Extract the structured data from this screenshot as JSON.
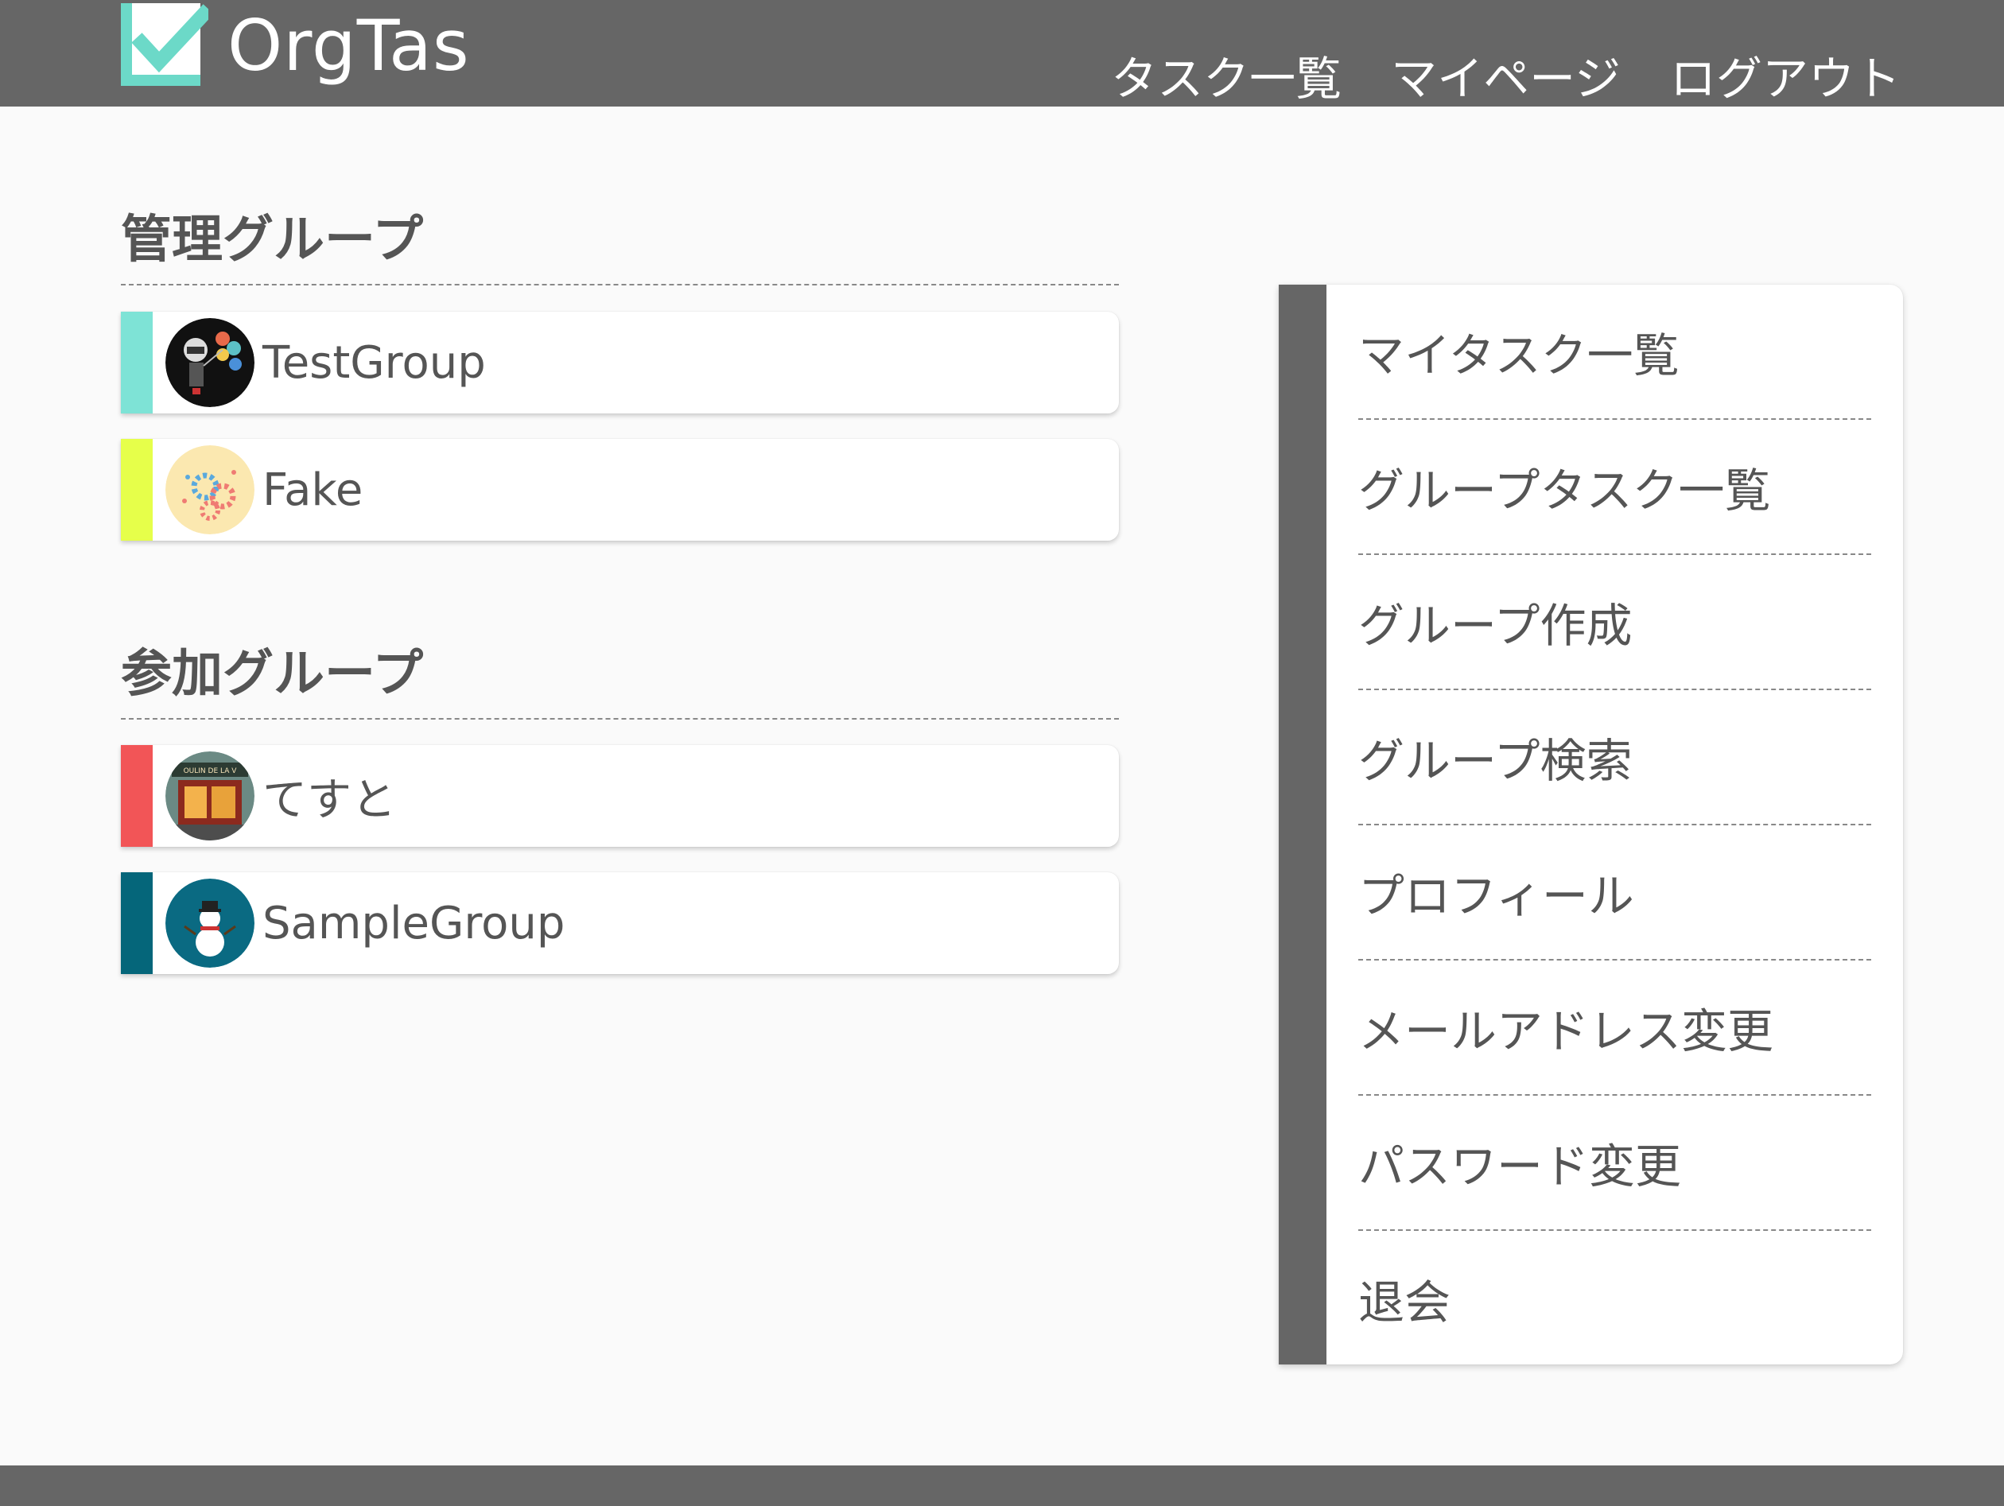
{
  "header": {
    "logo_text": "OrgTas",
    "nav": [
      "タスク一覧",
      "マイページ",
      "ログアウト"
    ]
  },
  "managed": {
    "title": "管理グループ",
    "groups": [
      {
        "name": "TestGroup",
        "color": "#7ee3d6",
        "avatar": "robot-balloons-icon"
      },
      {
        "name": "Fake",
        "color": "#e6ff4a",
        "avatar": "gears-icon"
      }
    ]
  },
  "joined": {
    "title": "参加グループ",
    "groups": [
      {
        "name": "てすと",
        "color": "#f25557",
        "avatar": "storefront-photo"
      },
      {
        "name": "SampleGroup",
        "color": "#05667a",
        "avatar": "snowman-icon"
      }
    ]
  },
  "sidebar": {
    "items": [
      "マイタスク一覧",
      "グループタスク一覧",
      "グループ作成",
      "グループ検索",
      "プロフィール",
      "メールアドレス変更",
      "パスワード変更",
      "退会"
    ]
  },
  "colors": {
    "header": "#666666",
    "accent": "#6cd9c8"
  }
}
